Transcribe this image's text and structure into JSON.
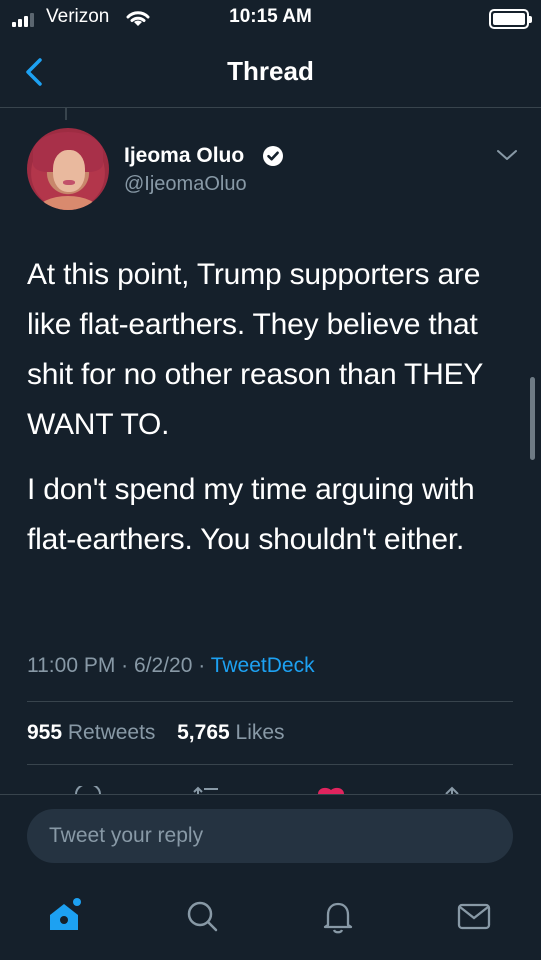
{
  "status_bar": {
    "carrier": "Verizon",
    "time": "10:15 AM"
  },
  "header": {
    "title": "Thread",
    "back_icon": "chevron-left-icon"
  },
  "tweet": {
    "author_name": "Ijeoma Oluo",
    "handle": "@IjeomaOluo",
    "verified": true,
    "paragraphs": [
      "At this point, Trump supporters are like flat-earthers. They believe that shit for no other reason than THEY WANT TO.",
      "I don't spend my time arguing with flat-earthers. You shouldn't either."
    ],
    "time": "11:00 PM",
    "date": "6/2/20",
    "separator": "·",
    "source": "TweetDeck",
    "retweets_count": "955",
    "retweets_label": "Retweets",
    "likes_count": "5,765",
    "likes_label": "Likes"
  },
  "reply": {
    "placeholder": "Tweet your reply"
  },
  "tabbar": {
    "items": [
      {
        "icon": "home-icon",
        "active": true
      },
      {
        "icon": "search-icon",
        "active": false
      },
      {
        "icon": "bell-icon",
        "active": false
      },
      {
        "icon": "mail-icon",
        "active": false
      }
    ]
  },
  "colors": {
    "background": "#15202b",
    "accent": "#1da1f2",
    "secondary_text": "#8899a6",
    "border": "#38444d",
    "like": "#e0245e"
  }
}
